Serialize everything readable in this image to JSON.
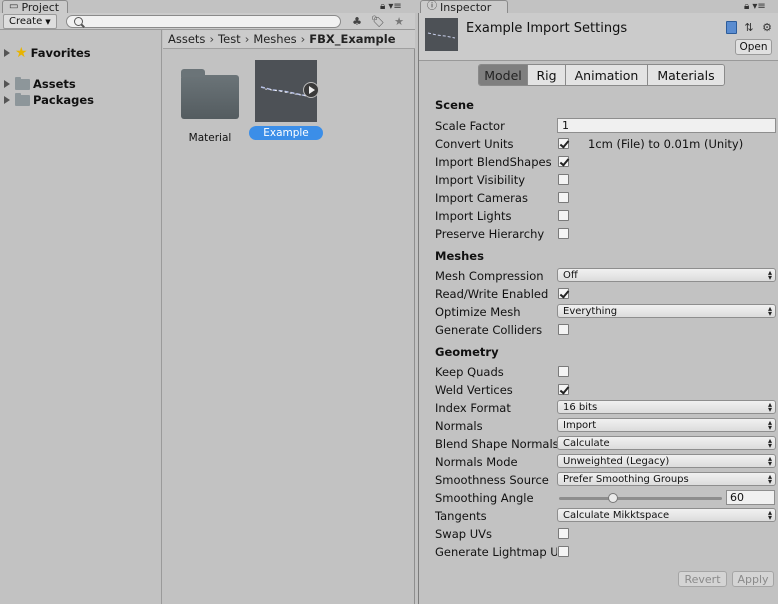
{
  "project_tab": {
    "title": "Project"
  },
  "inspector_tab": {
    "title": "Inspector"
  },
  "project": {
    "create_label": "Create",
    "search_placeholder": "",
    "tree": [
      {
        "label": "Favorites",
        "icon": "star-icon"
      },
      {
        "label": "Assets",
        "icon": "folder-icon"
      },
      {
        "label": "Packages",
        "icon": "folder-icon"
      }
    ],
    "breadcrumb": [
      "Assets",
      "Test",
      "Meshes",
      "FBX_Example"
    ],
    "assets": [
      {
        "label": "Material",
        "icon": "folder-icon",
        "selected": false
      },
      {
        "label": "Example",
        "icon": "mesh-thumbnail",
        "selected": true
      }
    ]
  },
  "inspector": {
    "title": "Example Import Settings",
    "open_label": "Open",
    "tabs": [
      "Model",
      "Rig",
      "Animation",
      "Materials"
    ],
    "active_tab": "Model",
    "scene": {
      "title": "Scene",
      "scale_factor_label": "Scale Factor",
      "scale_factor_value": "1",
      "convert_units_label": "Convert Units",
      "convert_units_checked": true,
      "convert_units_note": "1cm (File) to 0.01m (Unity)",
      "import_blendshapes_label": "Import BlendShapes",
      "import_blendshapes_checked": true,
      "import_visibility_label": "Import Visibility",
      "import_visibility_checked": false,
      "import_cameras_label": "Import Cameras",
      "import_cameras_checked": false,
      "import_lights_label": "Import Lights",
      "import_lights_checked": false,
      "preserve_hierarchy_label": "Preserve Hierarchy",
      "preserve_hierarchy_checked": false
    },
    "meshes": {
      "title": "Meshes",
      "mesh_compression_label": "Mesh Compression",
      "mesh_compression_value": "Off",
      "read_write_label": "Read/Write Enabled",
      "read_write_checked": true,
      "optimize_mesh_label": "Optimize Mesh",
      "optimize_mesh_value": "Everything",
      "generate_colliders_label": "Generate Colliders",
      "generate_colliders_checked": false
    },
    "geometry": {
      "title": "Geometry",
      "keep_quads_label": "Keep Quads",
      "keep_quads_checked": false,
      "weld_vertices_label": "Weld Vertices",
      "weld_vertices_checked": true,
      "index_format_label": "Index Format",
      "index_format_value": "16 bits",
      "normals_label": "Normals",
      "normals_value": "Import",
      "blend_shape_normals_label": "Blend Shape Normals",
      "blend_shape_normals_value": "Calculate",
      "normals_mode_label": "Normals Mode",
      "normals_mode_value": "Unweighted (Legacy)",
      "smoothness_source_label": "Smoothness Source",
      "smoothness_source_value": "Prefer Smoothing Groups",
      "smoothing_angle_label": "Smoothing Angle",
      "smoothing_angle_value": "60",
      "smoothing_angle_max": 180,
      "tangents_label": "Tangents",
      "tangents_value": "Calculate Mikktspace",
      "swap_uvs_label": "Swap UVs",
      "swap_uvs_checked": false,
      "generate_lightmap_label": "Generate Lightmap UV",
      "generate_lightmap_checked": false
    },
    "revert_label": "Revert",
    "apply_label": "Apply"
  }
}
